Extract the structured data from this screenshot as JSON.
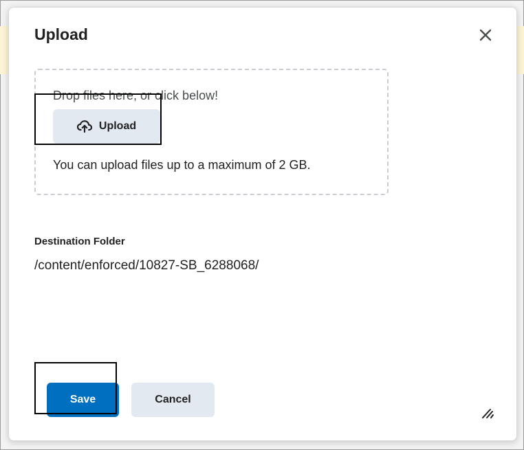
{
  "dialog": {
    "title": "Upload",
    "close_icon": "close-icon"
  },
  "dropzone": {
    "instruction": "Drop files here, or click below!",
    "upload_label": "Upload",
    "upload_icon": "cloud-upload-icon",
    "limit_text": "You can upload files up to a maximum of 2 GB."
  },
  "destination": {
    "label": "Destination Folder",
    "path": "/content/enforced/10827-SB_6288068/"
  },
  "footer": {
    "save_label": "Save",
    "cancel_label": "Cancel",
    "resize_icon": "resize-handle-icon"
  },
  "colors": {
    "primary": "#006fbf",
    "secondary_button": "#e3e9f1",
    "text": "#202122"
  }
}
